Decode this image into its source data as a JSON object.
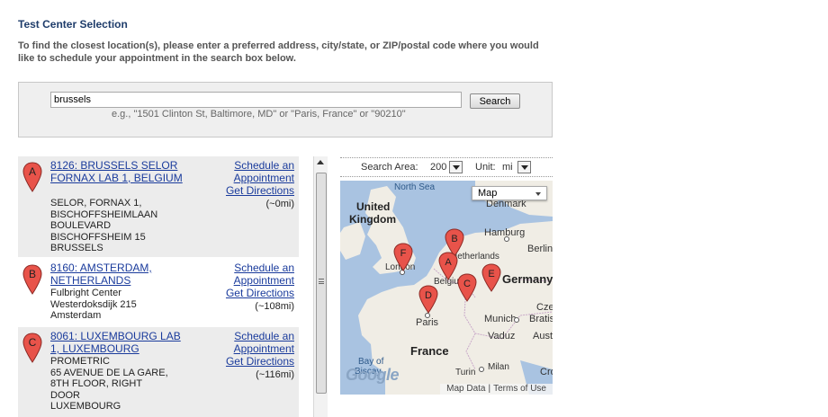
{
  "page": {
    "title": "Test Center Selection",
    "instructions": "To find the closest location(s), please enter a preferred address, city/state, or ZIP/postal code where you would like to schedule your appointment in the search box below."
  },
  "search": {
    "value": "brussels",
    "hint": "e.g., \"1501 Clinton St, Baltimore, MD\" or \"Paris, France\" or \"90210\"",
    "button_label": "Search"
  },
  "results": [
    {
      "marker": "A",
      "name": "8126: BRUSSELS SELOR FORNAX LAB 1, BELGIUM",
      "address": [
        "SELOR, FORNAX 1,",
        "BISCHOFFSHEIMLAAN",
        "BOULEVARD",
        "BISCHOFFSHEIM 15",
        "BRUSSELS"
      ],
      "schedule_label": "Schedule an Appointment",
      "directions_label": "Get Directions",
      "distance": "(~0mi)"
    },
    {
      "marker": "B",
      "name": "8160: AMSTERDAM, NETHERLANDS",
      "address": [
        "Fulbright Center",
        "Westerdoksdijk 215",
        "Amsterdam"
      ],
      "schedule_label": "Schedule an Appointment",
      "directions_label": "Get Directions",
      "distance": "(~108mi)"
    },
    {
      "marker": "C",
      "name": "8061: LUXEMBOURG LAB 1, LUXEMBOURG",
      "address": [
        "PROMETRIC",
        "65 AVENUE DE LA GARE,",
        "8TH FLOOR, RIGHT",
        "DOOR",
        "LUXEMBOURG"
      ],
      "schedule_label": "Schedule an Appointment",
      "directions_label": "Get Directions",
      "distance": "(~116mi)"
    }
  ],
  "map_controls": {
    "search_area_label": "Search Area:",
    "search_area_value": "200",
    "unit_label": "Unit:",
    "unit_value": "mi"
  },
  "map": {
    "type_label": "Map",
    "places": [
      "North Sea",
      "United",
      "Kingdom",
      "Denmark",
      "Hamburg",
      "Berlin",
      "London",
      "Netherlands",
      "Belgium",
      "Germany",
      "Paris",
      "France",
      "Munich",
      "Bratis",
      "Czec",
      "Vaduz",
      "Austr",
      "Bay of",
      "Biscay",
      "Turin",
      "Milan",
      "Cro"
    ],
    "markers": [
      "A",
      "B",
      "C",
      "D",
      "E",
      "F"
    ],
    "logo": "Google",
    "footer_links": [
      "Map Data",
      "Terms of Use"
    ],
    "colors": {
      "water": "#a9c3e1",
      "land": "#f0ede5",
      "marker": "#e8534a"
    }
  }
}
